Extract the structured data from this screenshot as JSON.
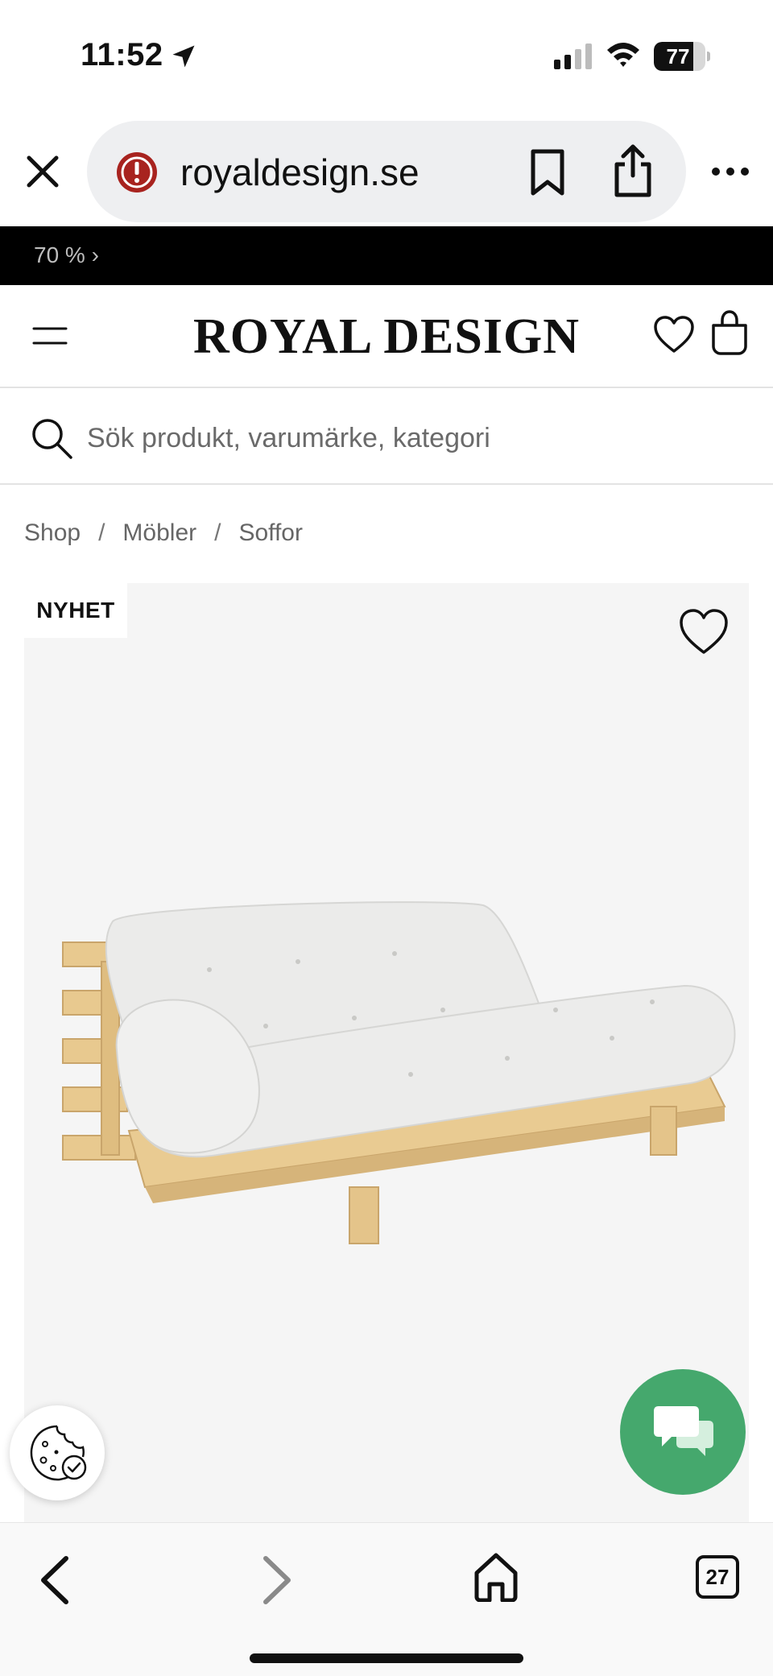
{
  "status_bar": {
    "time": "11:52",
    "battery": "77",
    "battery_level": 0.77,
    "icons": [
      "location-arrow-icon",
      "cell-signal-icon",
      "wifi-icon",
      "battery-icon"
    ]
  },
  "browser": {
    "url": "royaldesign.se",
    "icons": [
      "close-icon",
      "warning-icon",
      "bookmark-icon",
      "share-icon",
      "more-icon"
    ]
  },
  "promo": {
    "text": "70 % ›"
  },
  "header": {
    "logo": "ROYAL DESIGN",
    "icons": [
      "menu-icon",
      "heart-icon",
      "shopping-bag-icon"
    ]
  },
  "search": {
    "placeholder": "Sök produkt, varumärke, kategori",
    "value": ""
  },
  "breadcrumb": {
    "items": [
      "Shop",
      "Möbler",
      "Soffor"
    ],
    "separator": "/"
  },
  "product": {
    "badge": "NYHET",
    "background": "#f5f5f5",
    "image": "futon-sofa-natural-cushion"
  },
  "floating": {
    "cookie_icon": "cookie-settings-icon",
    "chat_icon": "chat-bubbles-icon",
    "chat_color": "#45a86d"
  },
  "toolbar": {
    "tab_count": "27",
    "icons": [
      "back-icon",
      "forward-icon",
      "home-icon",
      "tabs-icon"
    ]
  }
}
